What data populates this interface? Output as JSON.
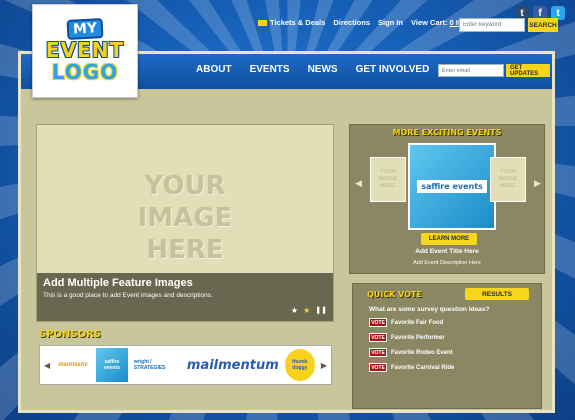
{
  "header": {
    "logo": {
      "line1": "MY",
      "line2": "EVENT",
      "line3": "LOGO"
    },
    "social": [
      {
        "name": "Tumblr",
        "glyph": "t",
        "color": "#2b4a6f"
      },
      {
        "name": "Facebook",
        "glyph": "f",
        "color": "#3b5b9d"
      },
      {
        "name": "Twitter",
        "glyph": "t",
        "color": "#2aa4ef"
      }
    ],
    "util_nav": {
      "tickets": "Tickets & Deals",
      "directions": "Directions",
      "sign_in": "Sign In",
      "view_cart": "View Cart:",
      "cart_items": "0 Item(s)"
    },
    "search": {
      "placeholder": "Enter keyword",
      "button": "SEARCH"
    }
  },
  "nav": {
    "items": [
      "ABOUT",
      "EVENTS",
      "NEWS",
      "GET INVOLVED"
    ],
    "email": {
      "placeholder": "Enter email",
      "button": "GET UPDATES"
    }
  },
  "feature": {
    "placeholder": [
      "YOUR",
      "IMAGE",
      "HERE"
    ],
    "title": "Add Multiple Feature Images",
    "description": "This is a good place to add Event images and descriptions."
  },
  "sponsors": {
    "title": "SPONSORS",
    "items": [
      "mamtastic",
      "saffire events",
      "wright / STRATEGIES",
      "mailmentum",
      "thumb doggy"
    ]
  },
  "events": {
    "title": "MORE EXCITING EVENTS",
    "side_placeholder": "YOUR IMAGE HERE",
    "featured_logo": "saffire events",
    "learn_more": "LEARN MORE",
    "event_title": "Add Event Title Here",
    "event_desc": "Add Event Description Here"
  },
  "quick_vote": {
    "title": "QUICK VOTE",
    "results": "RESULTS",
    "question": "What are some survey question ideas?",
    "vote_label": "VOTE",
    "options": [
      "Favorite Fair Food",
      "Favorite Performer",
      "Favorite Rodeo Event",
      "Favorite Carnival Ride"
    ]
  }
}
